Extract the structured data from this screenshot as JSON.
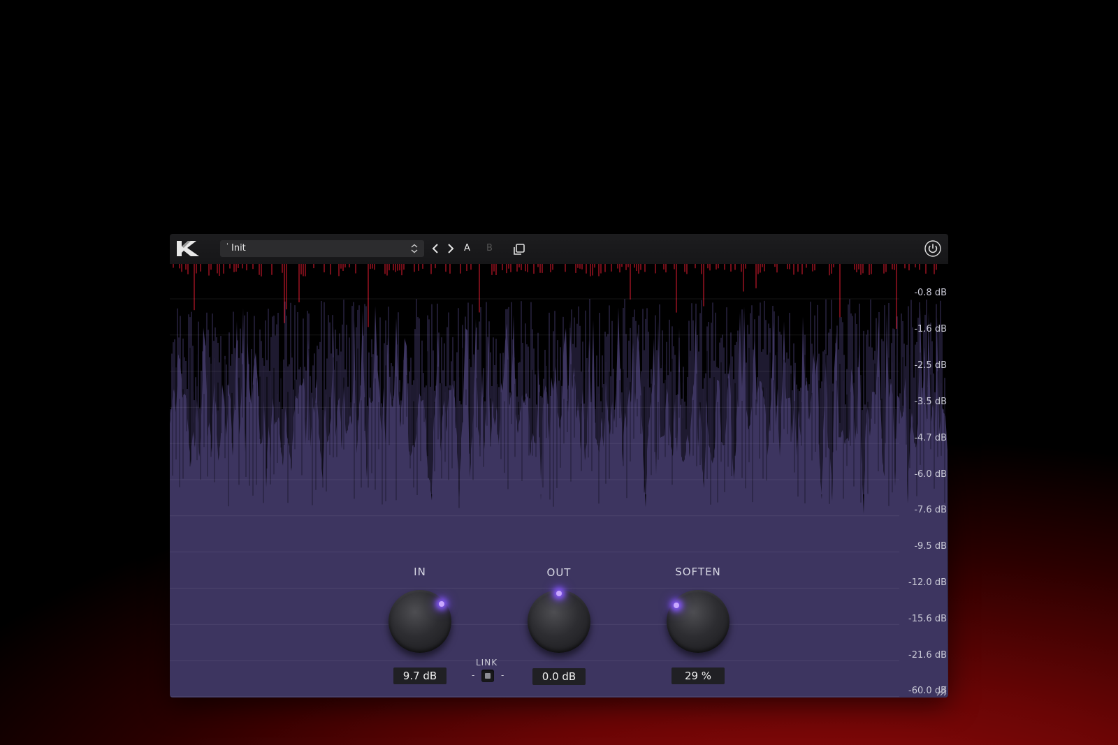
{
  "header": {
    "preset_marker": "'",
    "preset_name": "Init",
    "ab_a": "A",
    "ab_b": "B"
  },
  "icons": {
    "logo": "kilohearts-logo",
    "preset_updown": "chevron-updown-icon",
    "prev": "chevron-left-icon",
    "next": "chevron-right-icon",
    "copy": "copy-icon",
    "power": "power-icon",
    "resize": "resize-handle-icon"
  },
  "meter": {
    "db_labels": [
      "-0.8 dB",
      "-1.6 dB",
      "-2.5 dB",
      "-3.5 dB",
      "-4.7 dB",
      "-6.0 dB",
      "-7.6 dB",
      "-9.5 dB",
      "-12.0 dB",
      "-15.6 dB",
      "-21.6 dB",
      "-60.0 dB"
    ],
    "colors": {
      "signal": "#3d3560",
      "clipped": "#c0182a",
      "background": "#000000"
    }
  },
  "controls": {
    "in": {
      "label": "IN",
      "value": "9.7 dB"
    },
    "out": {
      "label": "OUT",
      "value": "0.0 dB"
    },
    "soften": {
      "label": "SOFTEN",
      "value": "29 %"
    },
    "link": {
      "label": "LINK",
      "dash_left": "-",
      "dash_right": "-"
    }
  },
  "colors": {
    "accent_glow": "#8a5cff",
    "panel": "#3d3560"
  }
}
